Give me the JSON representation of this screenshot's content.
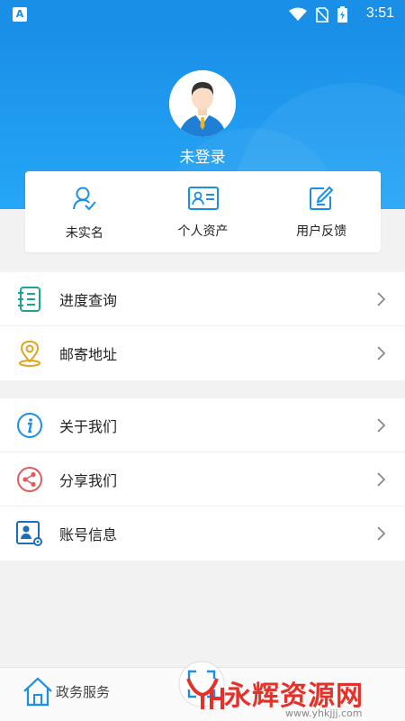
{
  "status_bar": {
    "time": "3:51",
    "app_badge": "A"
  },
  "profile": {
    "login_status": "未登录"
  },
  "quick_actions": [
    {
      "label": "未实名",
      "icon": "person-check-icon"
    },
    {
      "label": "个人资产",
      "icon": "id-card-icon"
    },
    {
      "label": "用户反馈",
      "icon": "edit-icon"
    }
  ],
  "menu_group_1": [
    {
      "label": "进度查询",
      "icon": "notebook-icon"
    },
    {
      "label": "邮寄地址",
      "icon": "location-pin-icon"
    }
  ],
  "menu_group_2": [
    {
      "label": "关于我们",
      "icon": "info-icon"
    },
    {
      "label": "分享我们",
      "icon": "share-icon"
    },
    {
      "label": "账号信息",
      "icon": "account-settings-icon"
    }
  ],
  "tab_bar": {
    "gov_services_label": "政务服务",
    "watermark_text": "永辉资源网",
    "watermark_url": "www.yhkjjj.com"
  },
  "colors": {
    "primary": "#1a8fe8",
    "teal": "#1aa58f",
    "gold": "#e0a51f",
    "red_share": "#e05c5c",
    "watermark": "#e4322b"
  }
}
